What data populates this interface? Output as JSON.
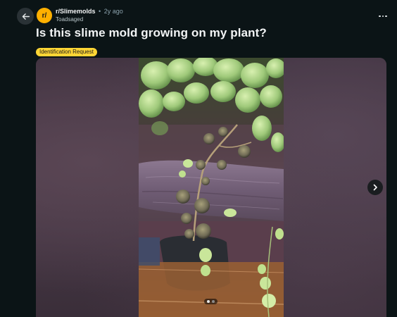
{
  "header": {
    "subreddit": "r/Slimemolds",
    "separator": "•",
    "age": "2y ago",
    "author": "Toadsaged",
    "avatar_text": "r/"
  },
  "post": {
    "title": "Is this slime mold growing on my plant?",
    "flair": "Identification Request",
    "flair_color": "#ffd635"
  },
  "gallery": {
    "slide_count": 2,
    "active_slide": 1
  },
  "icons": {
    "back": "arrow-left-icon",
    "more": "ellipsis-icon",
    "next": "chevron-right-icon"
  },
  "colors": {
    "background": "#0b1416",
    "subreddit_avatar": "#ffb000"
  }
}
